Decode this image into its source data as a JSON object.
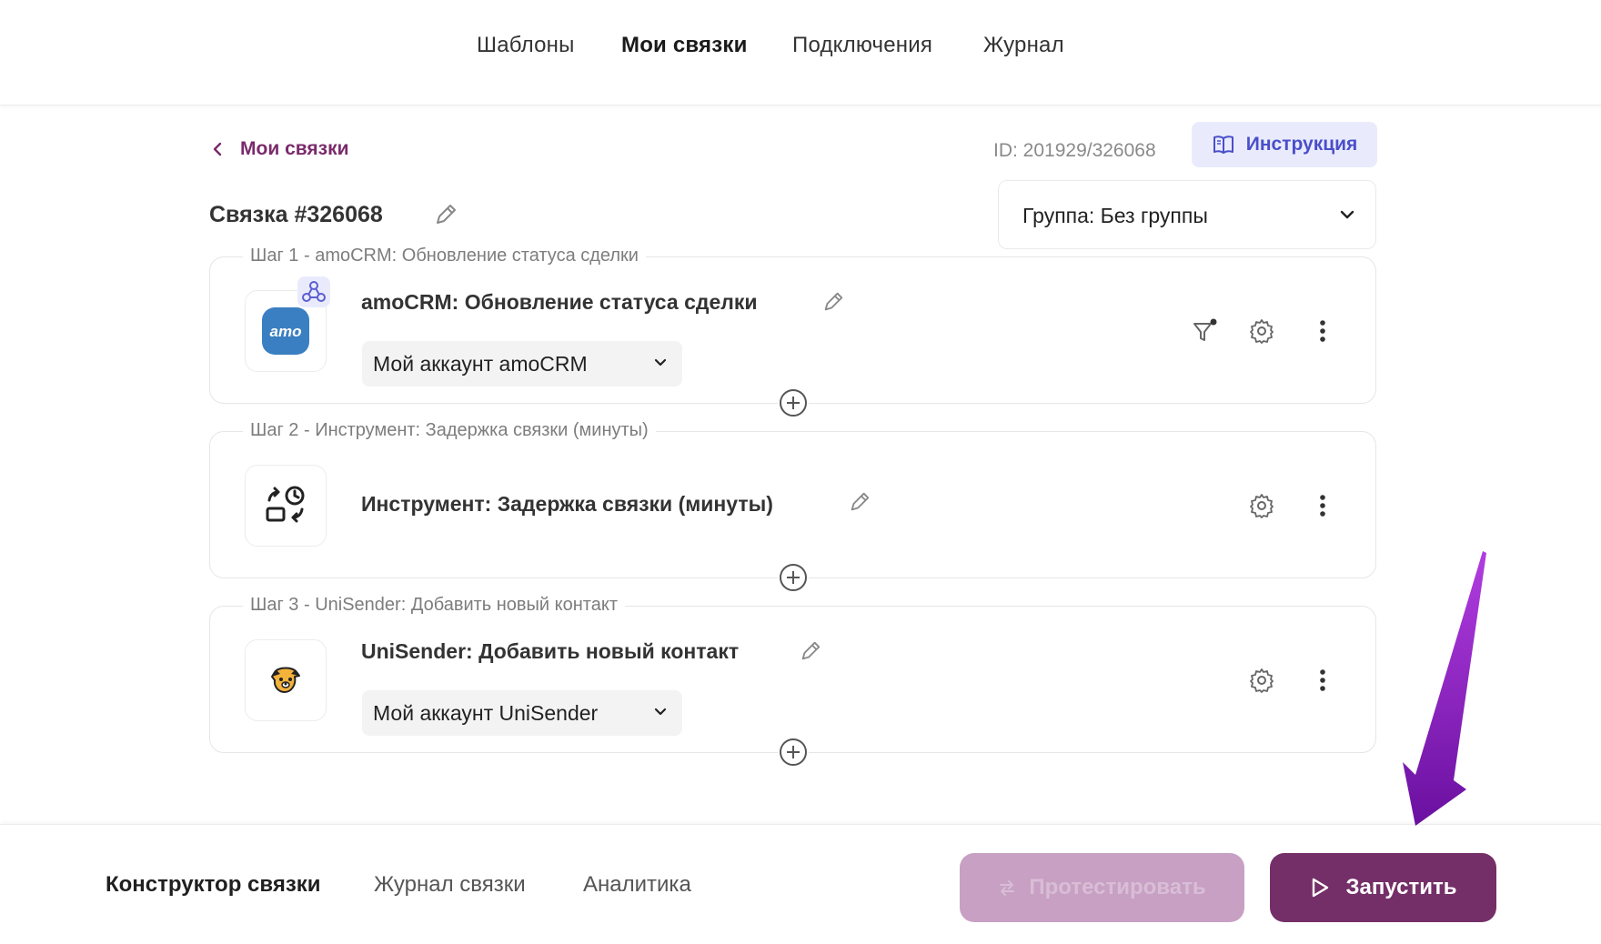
{
  "topnav": {
    "items": [
      {
        "label": "Шаблоны"
      },
      {
        "label": "Мои связки",
        "active": true
      },
      {
        "label": "Подключения"
      },
      {
        "label": "Журнал"
      }
    ]
  },
  "header": {
    "back_label": "Мои связки",
    "id_text": "ID: 201929/326068",
    "instruction_label": "Инструкция",
    "title": "Связка #326068",
    "group_label": "Группа: Без группы"
  },
  "steps": [
    {
      "legend": "Шаг 1 - amoCRM: Обновление статуса сделки",
      "title": "amoCRM: Обновление статуса сделки",
      "account": "Мой аккаунт amoCRM",
      "icon": "amocrm-logo",
      "badge_icon": "webhook-icon",
      "app_logo_text": "amo"
    },
    {
      "legend": "Шаг 2 - Инструмент: Задержка связки (минуты)",
      "title": "Инструмент: Задержка связки (минуты)",
      "icon": "delay-tool-icon"
    },
    {
      "legend": "Шаг 3 - UniSender: Добавить новый контакт",
      "title": "UniSender: Добавить новый контакт",
      "account": "Мой аккаунт UniSender",
      "icon": "unisender-logo"
    }
  ],
  "bottom": {
    "tabs": [
      {
        "label": "Конструктор связки",
        "active": true
      },
      {
        "label": "Журнал связки"
      },
      {
        "label": "Аналитика"
      }
    ],
    "test_label": "Протестировать",
    "run_label": "Запустить"
  },
  "colors": {
    "accent": "#742f68",
    "accent_disabled": "#c7a0c3",
    "link": "#7a2a6a",
    "instruction_bg": "#e9ebfd",
    "instruction_text": "#4a4fc9",
    "amocrm_blue": "#3a7fc1",
    "annotation_arrow": "#8a1fc0"
  }
}
